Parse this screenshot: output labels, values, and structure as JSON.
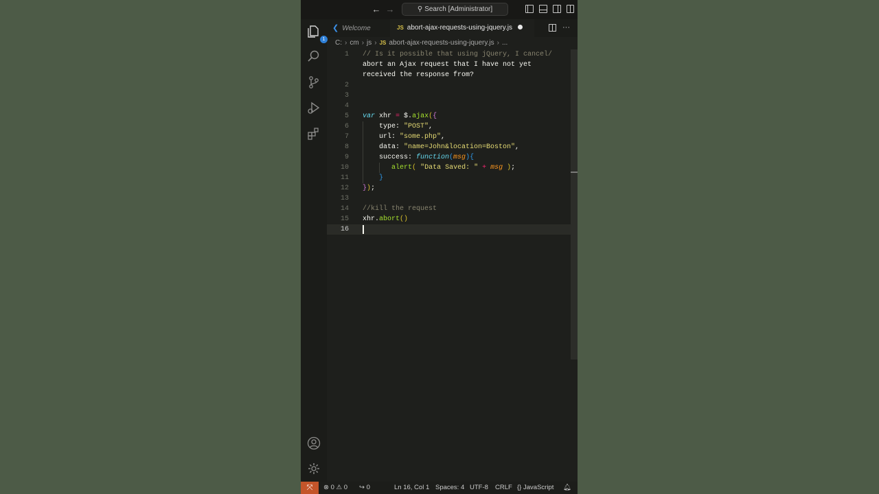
{
  "titlebar": {
    "back_icon": "arrow-left-icon",
    "forward_icon": "arrow-right-icon",
    "search_placeholder": "Search [Administrator]",
    "layout_icons": [
      "toggle-primary-sidebar-icon",
      "toggle-panel-icon",
      "toggle-secondary-sidebar-icon",
      "customize-layout-icon"
    ]
  },
  "activity_bar": {
    "items": [
      {
        "name": "explorer-icon",
        "badge": "1"
      },
      {
        "name": "search-icon"
      },
      {
        "name": "source-control-icon"
      },
      {
        "name": "run-debug-icon"
      },
      {
        "name": "extensions-icon"
      }
    ],
    "bottom": [
      {
        "name": "accounts-icon"
      },
      {
        "name": "manage-gear-icon"
      }
    ]
  },
  "tabs": [
    {
      "label": "Welcome",
      "icon": "vscode-logo-icon"
    },
    {
      "label": "abort-ajax-requests-using-jquery.js",
      "icon_text": "JS",
      "dirty": true,
      "active": true
    }
  ],
  "tab_actions": {
    "split": "split-editor-icon",
    "more": "···"
  },
  "breadcrumb": {
    "parts": [
      "C:",
      "cm",
      "js"
    ],
    "file_icon_text": "JS",
    "file": "abort-ajax-requests-using-jquery.js",
    "ellipsis": "..."
  },
  "editor": {
    "language": "JavaScript",
    "lines": [
      {
        "n": "1",
        "text": "// Is it possible that using jQuery, I cancel/"
      },
      {
        "n": "",
        "text": "abort an Ajax request that I have not yet"
      },
      {
        "n": "",
        "text": "received the response from?"
      },
      {
        "n": "2",
        "text": ""
      },
      {
        "n": "3",
        "text": ""
      },
      {
        "n": "4",
        "text": ""
      },
      {
        "n": "5",
        "text": "var xhr = $.ajax({"
      },
      {
        "n": "6",
        "text": "    type: \"POST\","
      },
      {
        "n": "7",
        "text": "    url: \"some.php\","
      },
      {
        "n": "8",
        "text": "    data: \"name=John&location=Boston\","
      },
      {
        "n": "9",
        "text": "    success: function(msg){"
      },
      {
        "n": "10",
        "text": "       alert( \"Data Saved: \" + msg );"
      },
      {
        "n": "11",
        "text": "    }"
      },
      {
        "n": "12",
        "text": "});"
      },
      {
        "n": "13",
        "text": ""
      },
      {
        "n": "14",
        "text": "//kill the request"
      },
      {
        "n": "15",
        "text": "xhr.abort()"
      },
      {
        "n": "16",
        "text": ""
      }
    ],
    "current_line": "16"
  },
  "statusbar": {
    "remote_icon": "remote-icon",
    "errors": "0",
    "warnings": "0",
    "ports": "0",
    "position": "Ln 16, Col 1",
    "spaces": "Spaces: 4",
    "encoding": "UTF-8",
    "eol": "CRLF",
    "language_icon": "{}",
    "language": "JavaScript",
    "notifications_icon": "bell-icon"
  }
}
